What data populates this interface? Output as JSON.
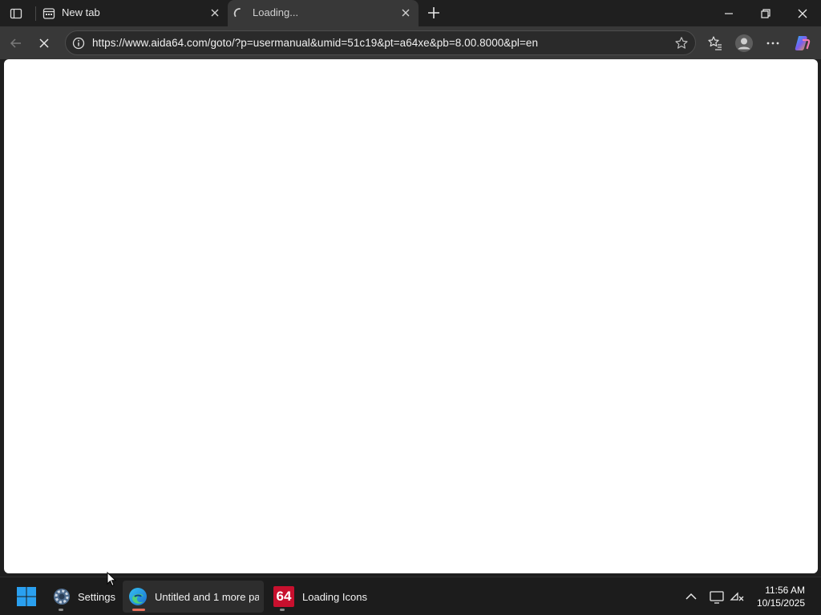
{
  "browser": {
    "tabs": [
      {
        "label": "New tab",
        "state": "inactive"
      },
      {
        "label": "Loading...",
        "state": "active-loading"
      }
    ],
    "address_bar": {
      "url": "https://www.aida64.com/goto/?p=usermanual&umid=51c19&pt=a64xe&pb=8.00.8000&pl=en"
    }
  },
  "taskbar": {
    "items": [
      {
        "label": "Settings"
      },
      {
        "label": "Untitled and 1 more pag"
      },
      {
        "label": "Loading Icons"
      }
    ],
    "aida_logo_text": "64",
    "clock": {
      "time": "11:56 AM",
      "date": "10/15/2025"
    }
  },
  "colors": {
    "accent_edge_indicator": "#e8705c",
    "aida_red": "#c8102e",
    "windows_blue": "#2aa0f0"
  }
}
